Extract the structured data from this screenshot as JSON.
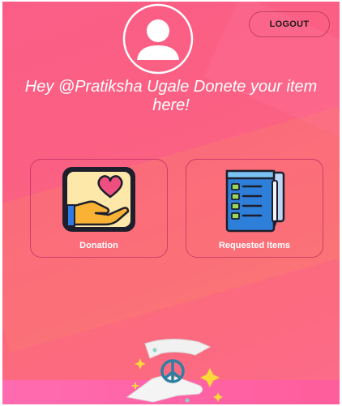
{
  "header": {
    "logout_label": "LOGOUT"
  },
  "headline": {
    "text": "Hey @Pratiksha Ugale Donete your item here!"
  },
  "cards": [
    {
      "label": "Donation",
      "icon": "heart-in-hand-icon"
    },
    {
      "label": "Requested Items",
      "icon": "checklist-icon"
    }
  ],
  "decor": {
    "bottom_art": "peace-hands-icon"
  },
  "colors": {
    "background": "#fb6183",
    "accent_band": "#fc826e",
    "text": "#ffffff"
  }
}
